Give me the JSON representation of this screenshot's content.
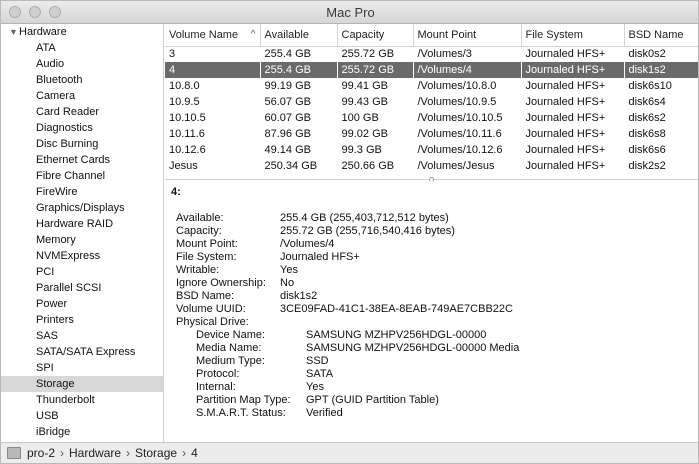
{
  "window": {
    "title": "Mac Pro"
  },
  "sidebar": {
    "header": "Hardware",
    "items": [
      "ATA",
      "Audio",
      "Bluetooth",
      "Camera",
      "Card Reader",
      "Diagnostics",
      "Disc Burning",
      "Ethernet Cards",
      "Fibre Channel",
      "FireWire",
      "Graphics/Displays",
      "Hardware RAID",
      "Memory",
      "NVMExpress",
      "PCI",
      "Parallel SCSI",
      "Power",
      "Printers",
      "SAS",
      "SATA/SATA Express",
      "SPI",
      "Storage",
      "Thunderbolt",
      "USB",
      "iBridge"
    ],
    "selected": "Storage"
  },
  "table": {
    "columns": [
      "Volume Name",
      "Available",
      "Capacity",
      "Mount Point",
      "File System",
      "BSD Name"
    ],
    "sort_indicator": "^",
    "rows": [
      [
        "3",
        "255.4 GB",
        "255.72 GB",
        "/Volumes/3",
        "Journaled HFS+",
        "disk0s2"
      ],
      [
        "4",
        "255.4 GB",
        "255.72 GB",
        "/Volumes/4",
        "Journaled HFS+",
        "disk1s2"
      ],
      [
        "10.8.0",
        "99.19 GB",
        "99.41 GB",
        "/Volumes/10.8.0",
        "Journaled HFS+",
        "disk6s10"
      ],
      [
        "10.9.5",
        "56.07 GB",
        "99.43 GB",
        "/Volumes/10.9.5",
        "Journaled HFS+",
        "disk6s4"
      ],
      [
        "10.10.5",
        "60.07 GB",
        "100 GB",
        "/Volumes/10.10.5",
        "Journaled HFS+",
        "disk6s2"
      ],
      [
        "10.11.6",
        "87.96 GB",
        "99.02 GB",
        "/Volumes/10.11.6",
        "Journaled HFS+",
        "disk6s8"
      ],
      [
        "10.12.6",
        "49.14 GB",
        "99.3 GB",
        "/Volumes/10.12.6",
        "Journaled HFS+",
        "disk6s6"
      ],
      [
        "Jesus",
        "250.34 GB",
        "250.66 GB",
        "/Volumes/Jesus",
        "Journaled HFS+",
        "disk2s2"
      ]
    ],
    "selected_row": 1
  },
  "detail": {
    "title": "4:",
    "fields": [
      {
        "k": "Available:",
        "v": "255.4 GB (255,403,712,512 bytes)"
      },
      {
        "k": "Capacity:",
        "v": "255.72 GB (255,716,540,416 bytes)"
      },
      {
        "k": "Mount Point:",
        "v": "/Volumes/4"
      },
      {
        "k": "File System:",
        "v": "Journaled HFS+"
      },
      {
        "k": "Writable:",
        "v": "Yes"
      },
      {
        "k": "Ignore Ownership:",
        "v": "No"
      },
      {
        "k": "BSD Name:",
        "v": "disk1s2"
      },
      {
        "k": "Volume UUID:",
        "v": "3CE09FAD-41C1-38EA-8EAB-749AE7CBB22C"
      },
      {
        "k": "Physical Drive:",
        "v": ""
      }
    ],
    "drive_fields": [
      {
        "k": "Device Name:",
        "v": "SAMSUNG MZHPV256HDGL-00000"
      },
      {
        "k": "Media Name:",
        "v": "SAMSUNG MZHPV256HDGL-00000 Media"
      },
      {
        "k": "Medium Type:",
        "v": "SSD"
      },
      {
        "k": "Protocol:",
        "v": "SATA"
      },
      {
        "k": "Internal:",
        "v": "Yes"
      },
      {
        "k": "Partition Map Type:",
        "v": "GPT (GUID Partition Table)"
      },
      {
        "k": "S.M.A.R.T. Status:",
        "v": "Verified"
      }
    ]
  },
  "pathbar": {
    "crumbs": [
      "pro-2",
      "Hardware",
      "Storage",
      "4"
    ],
    "separator": "›"
  },
  "icons": {
    "computer": "computer-icon",
    "disclosure": "disclosure-triangle-icon"
  }
}
